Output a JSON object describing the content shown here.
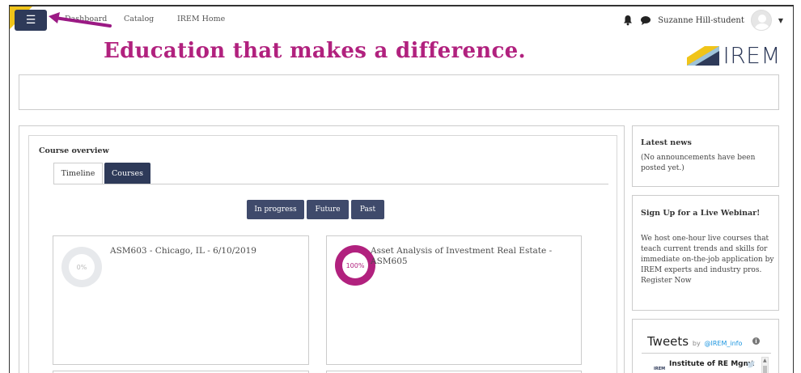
{
  "topbar": {
    "menu_icon": "hamburger-icon",
    "nav_links": [
      "Dashboard",
      "Catalog",
      "IREM Home"
    ],
    "user_name": "Suzanne Hill-student",
    "icons": [
      "bell-icon",
      "chat-icon",
      "avatar",
      "caret-down-icon"
    ]
  },
  "header": {
    "headline": "Education that makes a difference.",
    "logo_text": "IREM"
  },
  "course_overview": {
    "title": "Course overview",
    "tabs": [
      "Timeline",
      "Courses"
    ],
    "active_tab": "Courses",
    "filters": [
      "In progress",
      "Future",
      "Past"
    ],
    "courses": [
      {
        "title": "ASM603 - Chicago, IL - 6/10/2019",
        "progress_label": "0%",
        "progress": 0
      },
      {
        "title": "Asset Analysis of Investment Real Estate - ASM605",
        "progress_label": "100%",
        "progress": 100
      }
    ]
  },
  "sidebar": {
    "news": {
      "title": "Latest news",
      "text": "(No announcements have been posted yet.)"
    },
    "webinar": {
      "title": "Sign Up for a Live Webinar!",
      "text": "We host one-hour live courses that teach current trends and skills for immediate on-the-job application by IREM experts and industry pros.",
      "link": "Register Now"
    },
    "tweets": {
      "title": "Tweets",
      "by": "by",
      "handle": "@IREM_info",
      "first_tweet_author": "Institute of RE Mgmt",
      "tweet_logo_text": "IREM"
    }
  },
  "colors": {
    "brand_magenta": "#b1217e",
    "nav_dark": "#2e3a59",
    "annotation_arrow": "#9b1a84",
    "accent_yellow": "#f0c419"
  }
}
